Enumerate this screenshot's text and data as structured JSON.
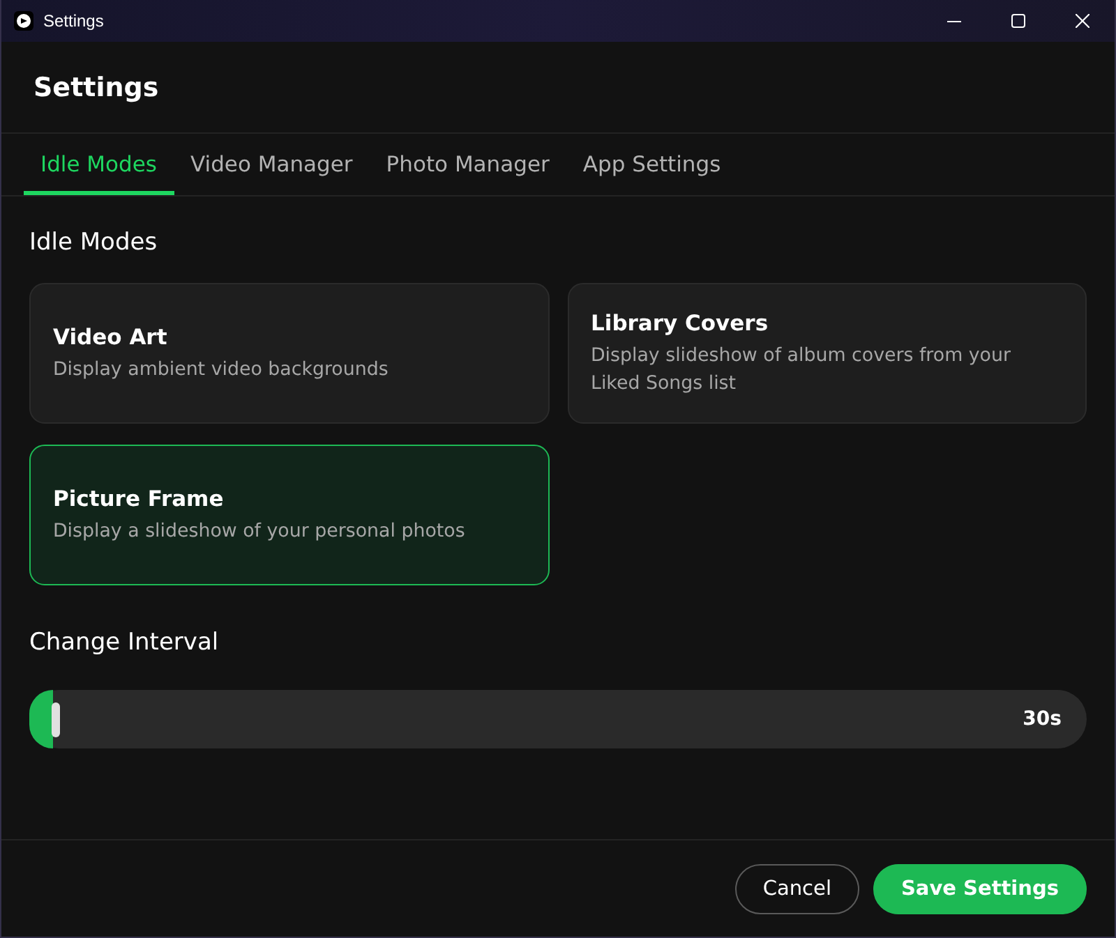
{
  "window": {
    "title": "Settings"
  },
  "header": {
    "title": "Settings"
  },
  "tabs": [
    {
      "label": "Idle Modes",
      "selected": true
    },
    {
      "label": "Video Manager",
      "selected": false
    },
    {
      "label": "Photo Manager",
      "selected": false
    },
    {
      "label": "App Settings",
      "selected": false
    }
  ],
  "idle_modes": {
    "heading": "Idle Modes",
    "modes": [
      {
        "title": "Video Art",
        "description": "Display ambient video backgrounds",
        "selected": false
      },
      {
        "title": "Library Covers",
        "description": "Display slideshow of album covers from your Liked Songs list",
        "selected": false
      },
      {
        "title": "Picture Frame",
        "description": "Display a slideshow of your personal photos",
        "selected": true
      }
    ]
  },
  "interval": {
    "heading": "Change Interval",
    "level": 0,
    "reading": "30s"
  },
  "buttons": [
    {
      "label": "Cancel",
      "kind": "secondary"
    },
    {
      "label": "Save Settings",
      "kind": "primary"
    }
  ]
}
